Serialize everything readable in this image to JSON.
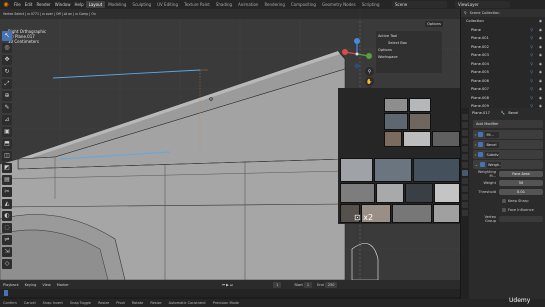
{
  "topbar": {
    "menus": [
      "File",
      "Edit",
      "Render",
      "Window",
      "Help"
    ],
    "workspaces": [
      "Layout",
      "Modeling",
      "Sculpting",
      "UV Editing",
      "Texture Paint",
      "Shading",
      "Animation",
      "Rendering",
      "Compositing",
      "Geometry Nodes",
      "Scripting"
    ],
    "active_workspace": "Layout",
    "scene": "Scene",
    "view_layer": "ViewLayer"
  },
  "viewport": {
    "header_text": "Vertex Select  |  ⊡ 0771  |  ⊡ over  |  Off  |  ∆t on  |  ⊡ Comp  |  On",
    "info_line1": "Right Orthographic",
    "info_line2": "(1) Plane.017",
    "info_line3": "10 Centimeters",
    "options_label": "Options",
    "active_tool_title": "Active Tool",
    "active_tool_item": "Select Box",
    "active_tool_options": "Options",
    "active_tool_workspace": "Workspace",
    "overlay_label": "⊡ x2",
    "tools": [
      "arrow-icon",
      "cursor-icon",
      "move-icon",
      "rotate-icon",
      "scale-icon",
      "transform-icon",
      "annotate-icon",
      "measure-icon",
      "cube-add-icon",
      "extrude-icon",
      "inset-icon",
      "bevel-icon",
      "loopcut-icon",
      "knife-icon",
      "polybuild-icon",
      "spin-icon",
      "smooth-icon",
      "edge-slide-icon",
      "shrink-icon",
      "shear-icon",
      "rip-icon"
    ]
  },
  "timeline": {
    "items": [
      "Playback",
      "Keying",
      "View",
      "Marker"
    ],
    "current_frame": "1",
    "start_label": "Start",
    "start": "1",
    "end_label": "End",
    "end": "250"
  },
  "status": {
    "items": [
      "Confirm",
      "Cancel",
      "Snap Invert",
      "Snap Toggle",
      "Resize",
      "Pivot",
      "Rotate",
      "Resize",
      "Automatic Constraint",
      "Precision Mode"
    ]
  },
  "outliner": {
    "title": "Scene Collection",
    "rows": [
      {
        "label": "Collection",
        "indent": 1
      },
      {
        "label": "Plane",
        "indent": 2
      },
      {
        "label": "Plane.001",
        "indent": 2
      },
      {
        "label": "Plane.002",
        "indent": 2
      },
      {
        "label": "Plane.003",
        "indent": 2
      },
      {
        "label": "Plane.004",
        "indent": 2
      },
      {
        "label": "Plane.005",
        "indent": 2
      },
      {
        "label": "Plane.006",
        "indent": 2
      },
      {
        "label": "Plane.007",
        "indent": 2
      },
      {
        "label": "Plane.008",
        "indent": 2
      },
      {
        "label": "Plane.009",
        "indent": 2
      }
    ]
  },
  "properties": {
    "object_name": "Plane.017",
    "modifier_name": "Bevel",
    "add_modifier": "Add Modifier",
    "modifiers": [
      "Mi...",
      "Bevel",
      "Subdiv...",
      "Weigh..."
    ],
    "weighting_label": "Weighting M...",
    "weighting_value": "Face Area",
    "weight_label": "Weight",
    "weight_value": "50",
    "threshold_label": "Threshold",
    "threshold_value": "0.01",
    "keep_sharp": "Keep Sharp",
    "face_influence": "Face Influence",
    "vertex_group": "Vertex Group"
  },
  "colors": {
    "accent": "#4772b3",
    "viewport_bg": "#3a3a3a",
    "selected_edge": "#5aa9e6",
    "brand_orange": "#e87d0d"
  },
  "watermark": "Udemy"
}
